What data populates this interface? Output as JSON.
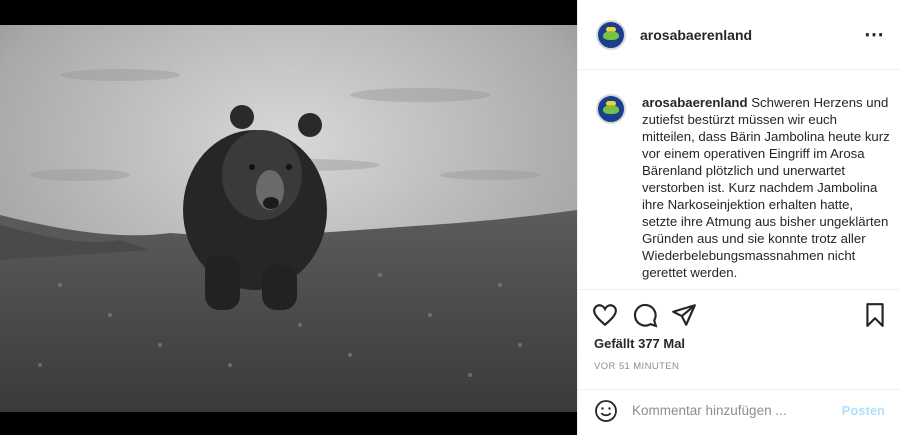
{
  "post": {
    "username": "arosabaerenland",
    "caption_text": "Schweren Herzens und zutiefst bestürzt müssen wir euch mitteilen, dass Bärin Jambolina heute kurz vor einem operativen Eingriff im Arosa Bärenland plötzlich und unerwartet verstorben ist. Kurz nachdem Jambolina ihre Narkoseinjektion erhalten hatte, setzte ihre Atmung aus bisher ungeklärten Gründen aus und sie konnte trotz aller Wiederbelebungsmassnahmen nicht gerettet werden.",
    "likes": "Gefällt 377 Mal",
    "timestamp": "VOR 51 MINUTEN"
  },
  "header": {
    "more_icon": "⋯"
  },
  "comment": {
    "placeholder": "Kommentar hinzufügen ...",
    "post_label": "Posten"
  },
  "icons": {
    "like": "heart-icon",
    "comment": "comment-icon",
    "share": "paper-plane-icon",
    "save": "bookmark-icon",
    "emoji": "smiley-icon"
  },
  "colors": {
    "post_button": "#b2dffc",
    "timestamp": "#8e8e8e"
  }
}
